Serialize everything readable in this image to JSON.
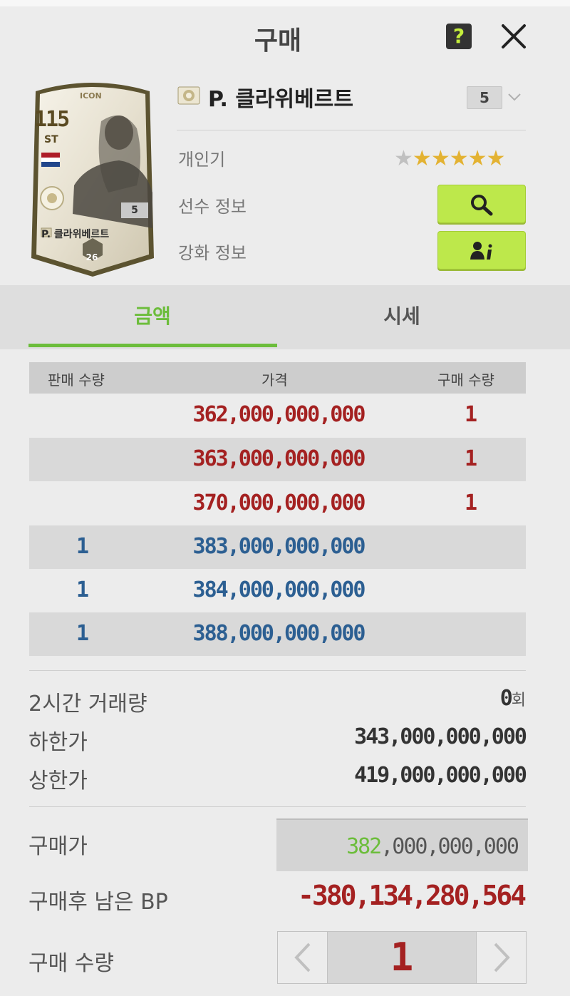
{
  "header": {
    "title": "구매",
    "help_label": "?"
  },
  "card": {
    "ovr": "115",
    "position": "ST",
    "badge": "ICON",
    "level": "5",
    "name": "P. 클라위베르트",
    "season": "26",
    "nationality_flag": "netherlands-flag"
  },
  "player": {
    "name": "P. 클라위베르트",
    "level": "5",
    "popularity_label": "개인기",
    "popularity_stars": 5,
    "max_stars": 6,
    "info_label": "선수 정보",
    "enhance_label": "강화 정보",
    "info_button_icon": "search-icon",
    "enhance_button_icon": "person-info-icon"
  },
  "tabs": [
    {
      "label": "금액",
      "active": true
    },
    {
      "label": "시세",
      "active": false
    }
  ],
  "table": {
    "headers": {
      "sell_qty": "판매 수량",
      "price": "가격",
      "buy_qty": "구매 수량"
    },
    "rows": [
      {
        "sell": "",
        "price": "362,000,000,000",
        "buy": "1",
        "color": "red"
      },
      {
        "sell": "",
        "price": "363,000,000,000",
        "buy": "1",
        "color": "red"
      },
      {
        "sell": "",
        "price": "370,000,000,000",
        "buy": "1",
        "color": "red"
      },
      {
        "sell": "1",
        "price": "383,000,000,000",
        "buy": "",
        "color": "blue"
      },
      {
        "sell": "1",
        "price": "384,000,000,000",
        "buy": "",
        "color": "blue"
      },
      {
        "sell": "1",
        "price": "388,000,000,000",
        "buy": "",
        "color": "blue"
      }
    ]
  },
  "stats": {
    "volume_label": "2시간 거래량",
    "volume_value": "0",
    "volume_unit": "회",
    "min_label": "하한가",
    "min_value": "343,000,000,000",
    "max_label": "상한가",
    "max_value": "419,000,000,000"
  },
  "purchase": {
    "price_label": "구매가",
    "price_prefix": "382",
    "price_suffix": ",000,000,000",
    "remaining_label": "구매후 남은 BP",
    "remaining_value": "-380,134,280,564",
    "qty_label": "구매 수량",
    "qty_value": "1",
    "prev_label": "‹",
    "next_label": "›"
  },
  "colors": {
    "accent_green": "#6cbd3b",
    "button_green": "#bde84b",
    "price_red": "#a42121",
    "price_blue": "#2c5f92",
    "star_gold": "#e3b232"
  }
}
